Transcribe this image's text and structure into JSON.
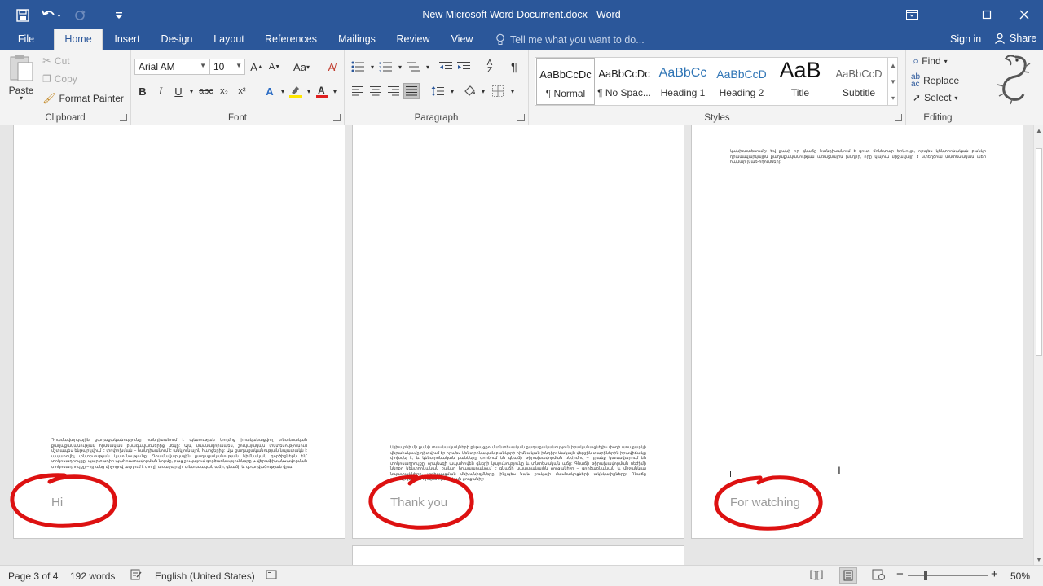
{
  "window": {
    "title": "New Microsoft Word Document.docx - Word"
  },
  "tabs": [
    {
      "label": "File"
    },
    {
      "label": "Home"
    },
    {
      "label": "Insert"
    },
    {
      "label": "Design"
    },
    {
      "label": "Layout"
    },
    {
      "label": "References"
    },
    {
      "label": "Mailings"
    },
    {
      "label": "Review"
    },
    {
      "label": "View"
    }
  ],
  "tell_me": {
    "placeholder": "Tell me what you want to do..."
  },
  "account": {
    "sign_in": "Sign in",
    "share": "Share"
  },
  "clipboard": {
    "paste": "Paste",
    "cut": "Cut",
    "copy": "Copy",
    "format_painter": "Format Painter",
    "label": "Clipboard"
  },
  "font": {
    "name": "Arial AM",
    "size": "10",
    "label": "Font",
    "bold": "B",
    "italic": "I",
    "underline": "U",
    "strike": "abc",
    "subscript": "x₂",
    "superscript": "x²"
  },
  "paragraph": {
    "label": "Paragraph"
  },
  "styles": {
    "label": "Styles",
    "items": [
      {
        "preview": "AaBbCcDc",
        "name": "¶ Normal"
      },
      {
        "preview": "AaBbCcDc",
        "name": "¶ No Spac..."
      },
      {
        "preview": "AaBbCc",
        "name": "Heading 1"
      },
      {
        "preview": "AaBbCcD",
        "name": "Heading 2"
      },
      {
        "preview": "AaB",
        "name": "Title"
      },
      {
        "preview": "AaBbCcD",
        "name": "Subtitle"
      }
    ]
  },
  "editing": {
    "find": "Find",
    "replace": "Replace",
    "select": "Select",
    "label": "Editing"
  },
  "pages": {
    "page1_text": "Դրամավարկային քաղաքականությունը հանդիսանում է պետության կողմից իրականացվող տնտեսական քաղաքականության հիմնական բնագավառներից մեկը: Այն, մասնավորապես, շուկայական տնտեսությունում մշտապես ենթարկվում է փոփոխման – հանդիսանում է անկյունային հարցերից: Այս քաղաքականության նպատակն է ապահովել տնտեսության կայունությունը: Դրամավարկային քաղաքականության հիմնական գործիքներն են՝ տոկոսադրույքը, պարտադիր պահուստավորման նորմը, բաց շուկայում գործառնությունները և վերաֆինանսավորման տոկոսադրույքը – դրանց միջոցով ազդում է փողի առաջարկի, տնտեսական աճի, գնաճի և զբաղվածության վրա:",
    "page2_text": "Աշխարհի մի քանի տասնամյակների ընթացքում տնտեսական քաղաքականություն իրականացնելիս փողի առաջարկի վերահսկումը դիտվում էր որպես կենտրոնական բանկերի հիմնական խնդիր: Սակայն վերջին տարիներին իրավիճակը փոխվել է, և կենտրոնական բանկերը գործում են գնաճի թիրախավորման ռեժիմով – դրանք կառավարում են տոկոսադրույքը, որպեսզի ապահովեն գների կայունությունը և տնտեսական աճը: Գնաճի թիրախավորման ռեժիմի ներքո կենտրոնական բանկը հրապարակում է գնաճի նպատակային ցուցանիշը – գործառնական և միջանկյալ նպատակները, փոխանցման մեխանիզմները, ինչպես նաև շուկայի մասնակիցների ակնկալիքները: Գնաճը դիտարկվում է որպես հիմնական ցուցանիշ:",
    "page3_text": "կանխատեսումը: Եվ քանի որ գնաճը հանդիսանում է զուտ մոնետար երևույթ, որպես կենտրոնական բանկի դրամավարկային քաղաքականության առաջնային խնդիր, որը կայուն միջավայր է ստեղծում տնտեսական աճի համար (կառ-հղումներ):",
    "handwriting": [
      "Hi",
      "Thank you",
      "For watching"
    ]
  },
  "status": {
    "page": "Page 3 of 4",
    "words": "192 words",
    "language": "English (United States)",
    "zoom": "50%"
  }
}
